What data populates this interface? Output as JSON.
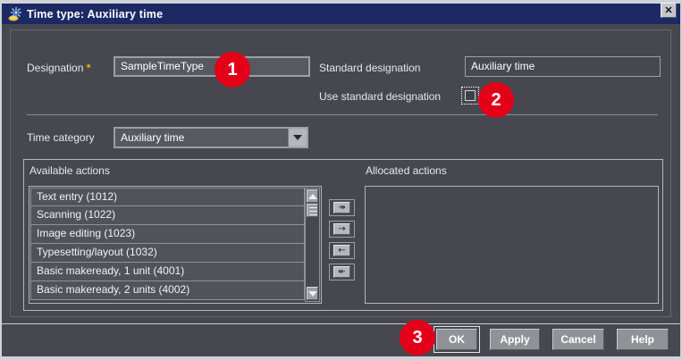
{
  "window": {
    "title": "Time type: Auxiliary time",
    "close_glyph": "✕"
  },
  "form": {
    "designation": {
      "label": "Designation",
      "required_mark": "*",
      "value": "SampleTimeType"
    },
    "standard_designation": {
      "label": "Standard designation",
      "value": "Auxiliary time"
    },
    "use_standard_designation": {
      "label": "Use standard designation",
      "checked": false
    },
    "time_category": {
      "label": "Time category",
      "value": "Auxiliary time"
    }
  },
  "actions": {
    "available": {
      "label": "Available actions",
      "items": [
        "Text entry (1012)",
        "Scanning (1022)",
        "Image editing (1023)",
        "Typesetting/layout (1032)",
        "Basic makeready, 1 unit (4001)",
        "Basic makeready, 2 units (4002)"
      ]
    },
    "allocated": {
      "label": "Allocated actions",
      "items": []
    },
    "transfer": [
      {
        "name": "move-all-right",
        "glyph": "↠"
      },
      {
        "name": "move-right",
        "glyph": "→"
      },
      {
        "name": "move-left",
        "glyph": "←"
      },
      {
        "name": "move-all-left",
        "glyph": "↞"
      }
    ]
  },
  "footer": {
    "buttons": [
      {
        "name": "ok",
        "label": "OK"
      },
      {
        "name": "apply",
        "label": "Apply"
      },
      {
        "name": "cancel",
        "label": "Cancel"
      },
      {
        "name": "help",
        "label": "Help"
      }
    ]
  },
  "annotations": [
    {
      "number": "1"
    },
    {
      "number": "2"
    },
    {
      "number": "3"
    }
  ],
  "colors": {
    "title_bar": "#1c2964",
    "dialog_bg": "#47484f",
    "badge_red": "#e50019",
    "required_gold": "#f0b400",
    "button_gray": "#8f9397"
  }
}
